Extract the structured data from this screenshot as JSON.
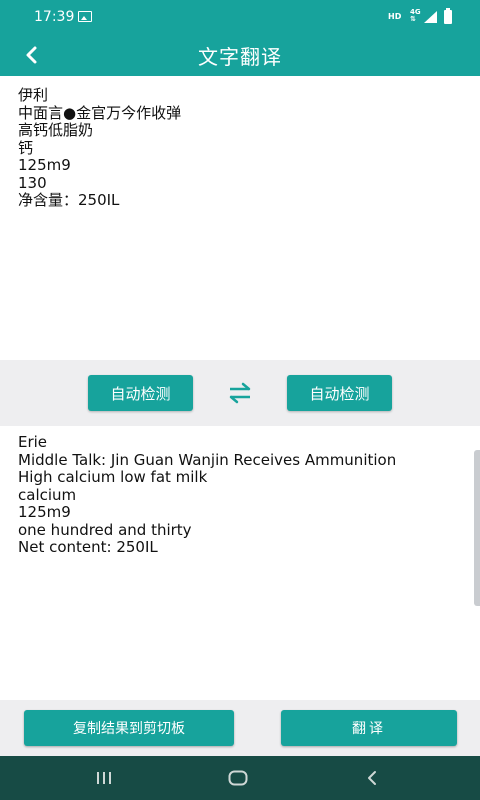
{
  "status_bar": {
    "time": "17:39",
    "hd": "HD",
    "network": "4G",
    "icons": [
      "image-icon",
      "signal-icon",
      "battery-icon"
    ]
  },
  "app_bar": {
    "title": "文字翻译",
    "back_icon": "chevron-left-icon"
  },
  "source": {
    "lines": [
      "伊利",
      "中面言●金官万今作收弹",
      "高钙低脂奶",
      "钙",
      "125m9",
      "130",
      "净含量：250IL"
    ]
  },
  "languages": {
    "source_label": "自动检测",
    "target_label": "自动检测",
    "swap_icon": "swap-arrows-icon"
  },
  "result": {
    "lines": [
      "Erie",
      "Middle Talk: Jin Guan Wanjin Receives Ammunition",
      "High calcium low fat milk",
      "calcium",
      "125m9",
      "one hundred and thirty",
      "Net content: 250IL"
    ]
  },
  "actions": {
    "copy_label": "复制结果到剪切板",
    "translate_label": "翻译"
  },
  "colors": {
    "primary": "#17a39c",
    "nav_bar": "#174b45",
    "panel_gray": "#eeeef0"
  }
}
